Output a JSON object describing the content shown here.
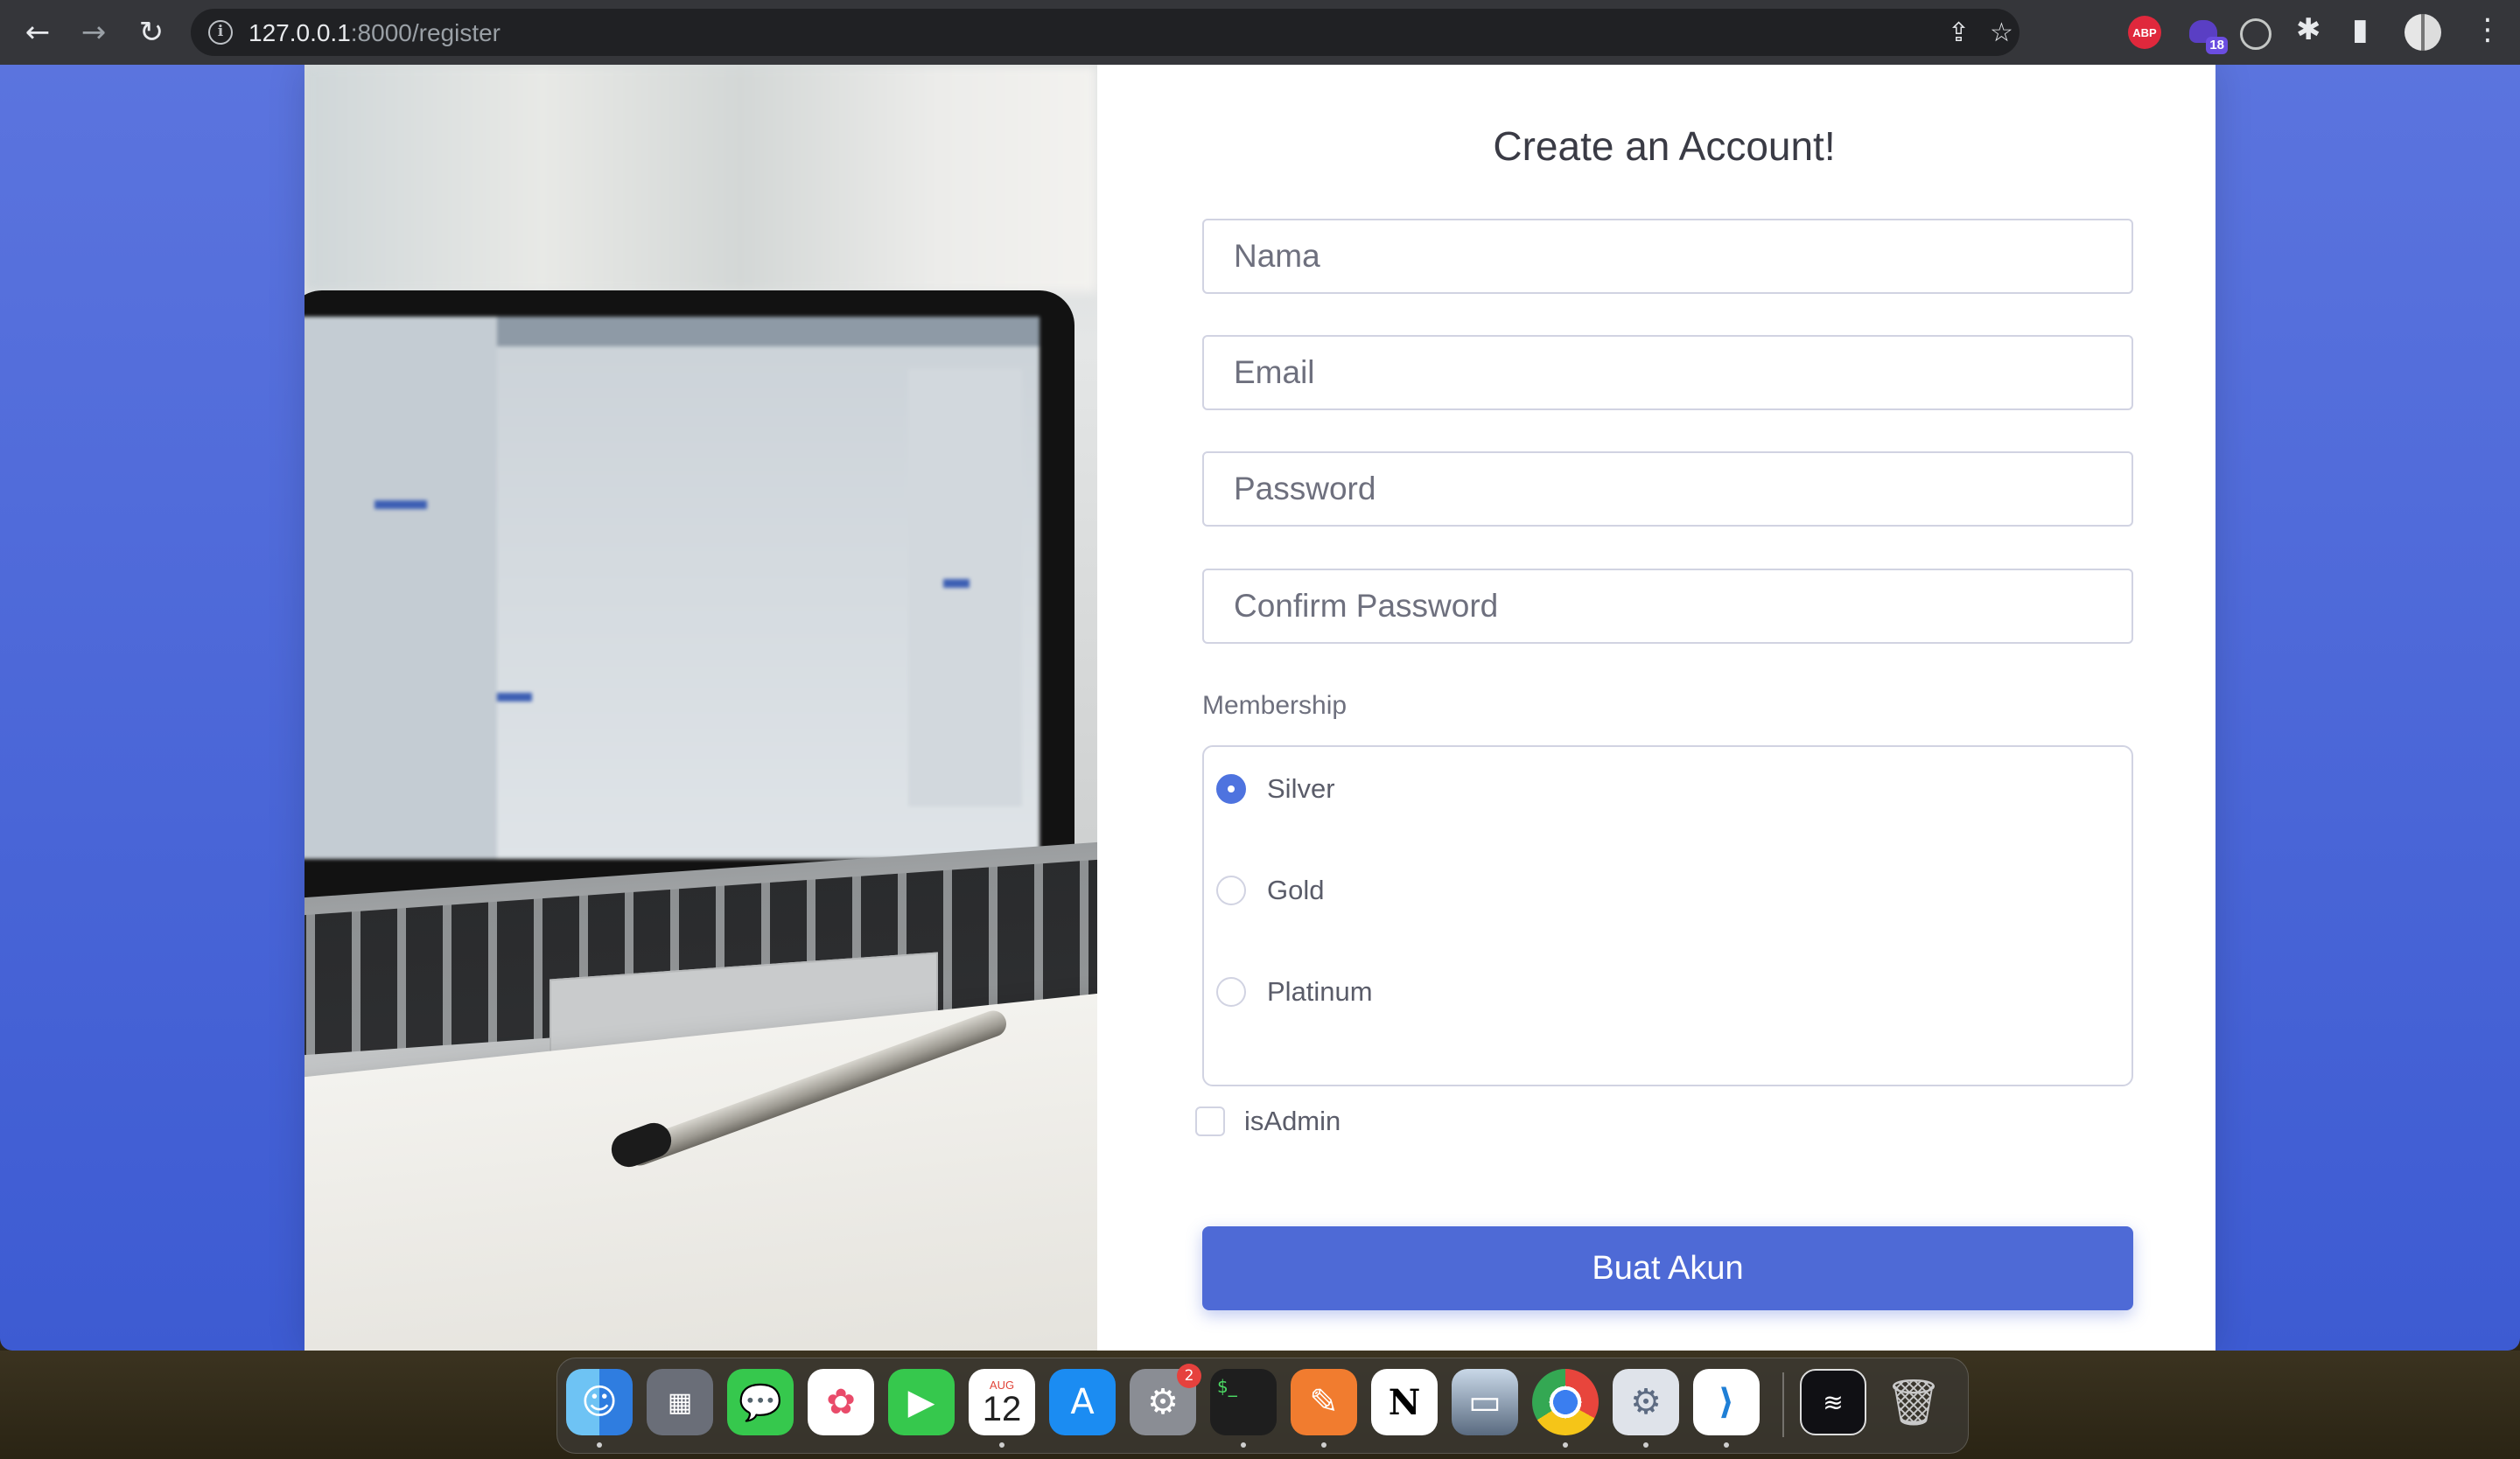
{
  "browser": {
    "url_host": "127.0.0.1",
    "url_rest": ":8000/register",
    "extension_badge_count": "18",
    "abp_label": "ABP"
  },
  "form": {
    "title": "Create an Account!",
    "fields": {
      "name_placeholder": "Nama",
      "email_placeholder": "Email",
      "password_placeholder": "Password",
      "confirm_password_placeholder": "Confirm Password"
    },
    "membership_label": "Membership",
    "membership_options": [
      "Silver",
      "Gold",
      "Platinum"
    ],
    "membership_selected": "Silver",
    "is_admin_label": "isAdmin",
    "is_admin_checked": false,
    "submit_label": "Buat Akun"
  },
  "dock": {
    "calendar_month": "AUG",
    "calendar_day": "12",
    "system_prefs_badge": "2",
    "apps": [
      "finder-icon",
      "launchpad-icon",
      "messages-icon",
      "photos-icon",
      "facetime-icon",
      "calendar-icon",
      "app-store-icon",
      "system-preferences-icon",
      "terminal-icon",
      "pen-app-icon",
      "notion-icon",
      "preview-icon",
      "chrome-icon",
      "settings-icon",
      "vscode-icon",
      "screenshot-folder-icon",
      "trash-icon"
    ]
  },
  "colors": {
    "page_gradient_top": "#5b74de",
    "page_gradient_bottom": "#3d5bd2",
    "primary_button": "#4e6ad6",
    "radio_checked": "#4e73df"
  }
}
